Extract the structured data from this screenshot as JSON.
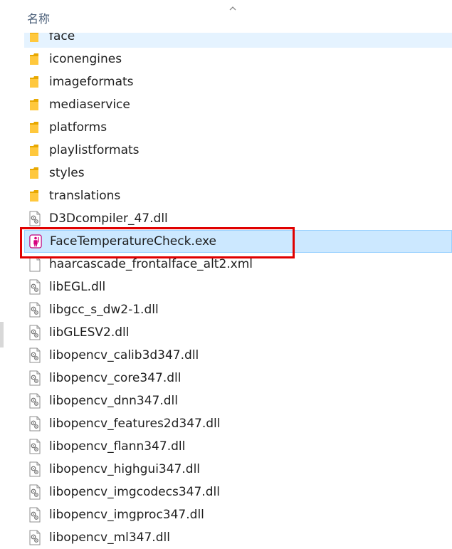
{
  "header": {
    "name_column": "名称",
    "sort_icon": "chevron-up-icon"
  },
  "rows": [
    {
      "name": "face",
      "type": "folder"
    },
    {
      "name": "iconengines",
      "type": "folder"
    },
    {
      "name": "imageformats",
      "type": "folder"
    },
    {
      "name": "mediaservice",
      "type": "folder"
    },
    {
      "name": "platforms",
      "type": "folder"
    },
    {
      "name": "playlistformats",
      "type": "folder"
    },
    {
      "name": "styles",
      "type": "folder"
    },
    {
      "name": "translations",
      "type": "folder"
    },
    {
      "name": "D3Dcompiler_47.dll",
      "type": "dll"
    },
    {
      "name": "FaceTemperatureCheck.exe",
      "type": "exe",
      "selected": true
    },
    {
      "name": "haarcascade_frontalface_alt2.xml",
      "type": "xml"
    },
    {
      "name": "libEGL.dll",
      "type": "dll"
    },
    {
      "name": "libgcc_s_dw2-1.dll",
      "type": "dll"
    },
    {
      "name": "libGLESV2.dll",
      "type": "dll"
    },
    {
      "name": "libopencv_calib3d347.dll",
      "type": "dll"
    },
    {
      "name": "libopencv_core347.dll",
      "type": "dll"
    },
    {
      "name": "libopencv_dnn347.dll",
      "type": "dll"
    },
    {
      "name": "libopencv_features2d347.dll",
      "type": "dll"
    },
    {
      "name": "libopencv_flann347.dll",
      "type": "dll"
    },
    {
      "name": "libopencv_highgui347.dll",
      "type": "dll"
    },
    {
      "name": "libopencv_imgcodecs347.dll",
      "type": "dll"
    },
    {
      "name": "libopencv_imgproc347.dll",
      "type": "dll"
    },
    {
      "name": "libopencv_ml347.dll",
      "type": "dll"
    }
  ],
  "colors": {
    "selection_bg": "#cce8ff",
    "selection_border": "#99d1ff",
    "annotation_red": "#e00000",
    "folder_yellow": "#ffc83d"
  }
}
